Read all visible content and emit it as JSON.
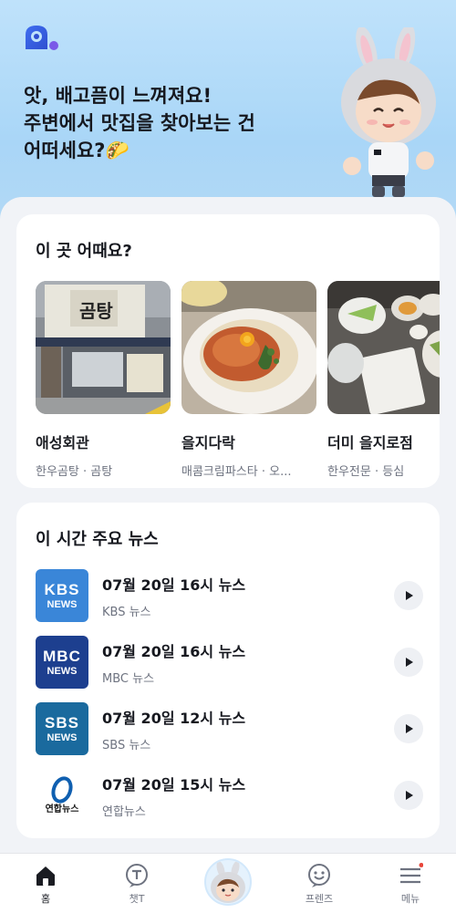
{
  "hero": {
    "title_lines": [
      "앗, 배고픔이 느껴져요!",
      "주변에서 맛집을 찾아보는 건",
      "어떠세요?🌮"
    ]
  },
  "places": {
    "title": "이 곳 어때요?",
    "items": [
      {
        "name": "애성회관",
        "desc": "한우곰탕 · 곰탕"
      },
      {
        "name": "을지다락",
        "desc": "매콤크림파스타 · 오..."
      },
      {
        "name": "더미 을지로점",
        "desc": "한우전문 · 등심"
      }
    ]
  },
  "news": {
    "title": "이 시간 주요 뉴스",
    "items": [
      {
        "title": "07월 20일 16시 뉴스",
        "source": "KBS 뉴스",
        "logo_top": "KBS",
        "logo_bottom": "NEWS",
        "color": "#3a86d8"
      },
      {
        "title": "07월 20일 16시 뉴스",
        "source": "MBC 뉴스",
        "logo_top": "MBC",
        "logo_bottom": "NEWS",
        "color": "#1d3f8f"
      },
      {
        "title": "07월 20일 12시 뉴스",
        "source": "SBS 뉴스",
        "logo_top": "SBS",
        "logo_bottom": "NEWS",
        "color": "#1a6a9e"
      },
      {
        "title": "07월 20일 15시 뉴스",
        "source": "연합뉴스",
        "logo_bottom": "연합뉴스",
        "color": "#0f5fb0"
      }
    ]
  },
  "tabbar": {
    "items": [
      {
        "label": "홈",
        "icon": "home-icon",
        "active": true
      },
      {
        "label": "챗T",
        "icon": "chat-icon"
      },
      {
        "label": "",
        "icon": "avatar"
      },
      {
        "label": "프렌즈",
        "icon": "friends-icon"
      },
      {
        "label": "메뉴",
        "icon": "menu-icon",
        "badge": true
      }
    ]
  },
  "colors": {
    "accent": "#3a64e8",
    "hero_bg": "#b6dbf8",
    "badge": "#e8463a"
  }
}
